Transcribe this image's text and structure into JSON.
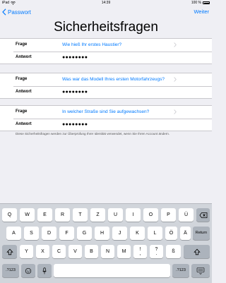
{
  "status_bar": {
    "device": "iPad",
    "time": "14:39",
    "battery": "100 %"
  },
  "nav": {
    "back_label": "Passwort",
    "next_label": "Weiter"
  },
  "page_title": "Sicherheitsfragen",
  "questions": [
    {
      "question_label": "Frage",
      "question": "Wie hieß Ihr erstes Haustier?",
      "answer_label": "Antwort",
      "answer": "●●●●●●●●"
    },
    {
      "question_label": "Frage",
      "question": "Was war das Modell Ihres ersten Motorfahrzeugs?",
      "answer_label": "Antwort",
      "answer": "●●●●●●●●"
    },
    {
      "question_label": "Frage",
      "question": "In welcher Straße sind Sie aufgewachsen?",
      "answer_label": "Antwort",
      "answer": "●●●●●●●●"
    }
  ],
  "footnote": "Diese Sicherheitsfragen werden zur Überprüfung Ihrer Identität verwendet, wenn Sie Ihren Account ändern.",
  "keyboard": {
    "row1": [
      "Q",
      "W",
      "E",
      "R",
      "T",
      "Z",
      "U",
      "I",
      "O",
      "P",
      "Ü"
    ],
    "row2": [
      "A",
      "S",
      "D",
      "F",
      "G",
      "H",
      "J",
      "K",
      "L",
      "Ö",
      "Ä"
    ],
    "row3": [
      "Y",
      "X",
      "C",
      "V",
      "B",
      "N",
      "M",
      "!",
      "?",
      "ß"
    ],
    "row3_extra_punct": [
      ",",
      "."
    ],
    "return_label": "Return",
    "numbers_label": ".?123",
    "icons": [
      "backspace-icon",
      "shift-icon",
      "emoji-icon",
      "microphone-icon",
      "keyboard-dismiss-icon"
    ]
  },
  "colors": {
    "accent": "#007aff",
    "background": "#efeff4",
    "keyboard": "#d1d5db",
    "key_dark": "#acb3bc"
  }
}
